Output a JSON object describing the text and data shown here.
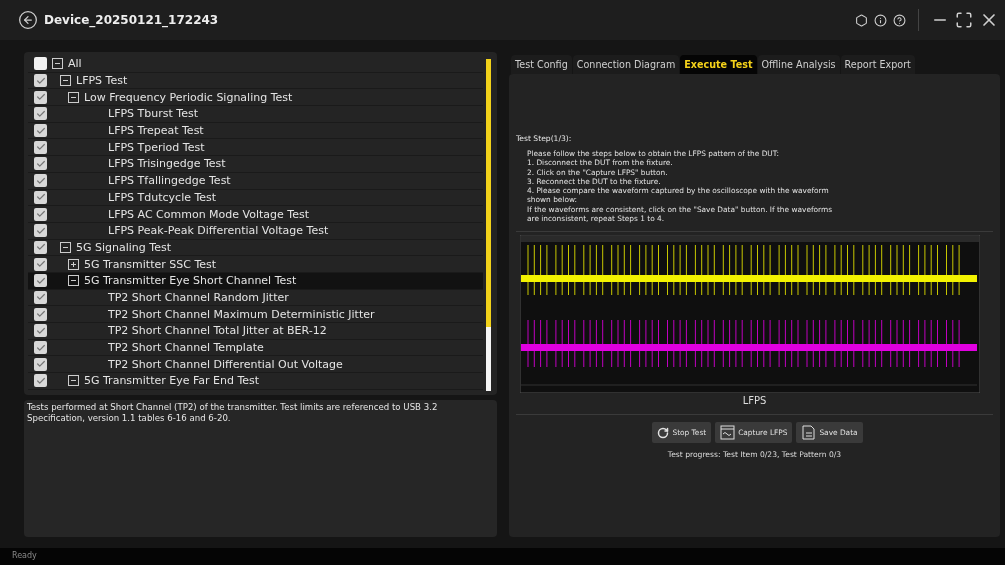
{
  "window": {
    "title": "Device_20250121_172243"
  },
  "tree": [
    {
      "label": "All",
      "checked": false,
      "expanded": true,
      "selected": false,
      "children": [
        {
          "label": "LFPS Test",
          "checked": true,
          "expanded": true,
          "selected": false,
          "children": [
            {
              "label": "Low Frequency Periodic Signaling Test",
              "checked": true,
              "expanded": true,
              "selected": false,
              "children": [
                {
                  "label": "LFPS Tburst Test",
                  "checked": true,
                  "selected": false
                },
                {
                  "label": "LFPS Trepeat Test",
                  "checked": true,
                  "selected": false
                },
                {
                  "label": "LFPS Tperiod Test",
                  "checked": true,
                  "selected": false
                },
                {
                  "label": "LFPS Trisingedge Test",
                  "checked": true,
                  "selected": false
                },
                {
                  "label": "LFPS Tfallingedge Test",
                  "checked": true,
                  "selected": false
                },
                {
                  "label": "LFPS Tdutcycle Test",
                  "checked": true,
                  "selected": false
                },
                {
                  "label": "LFPS AC Common Mode Voltage Test",
                  "checked": true,
                  "selected": false
                },
                {
                  "label": "LFPS Peak-Peak Differential Voltage Test",
                  "checked": true,
                  "selected": false
                }
              ]
            }
          ]
        },
        {
          "label": "5G Signaling Test",
          "checked": true,
          "expanded": true,
          "selected": false,
          "children": [
            {
              "label": "5G Transmitter SSC Test",
              "checked": true,
              "expanded": false,
              "selected": false
            },
            {
              "label": "5G Transmitter Eye Short Channel Test",
              "checked": true,
              "expanded": true,
              "selected": true,
              "children": [
                {
                  "label": "TP2 Short Channel Random Jitter",
                  "checked": true,
                  "selected": false
                },
                {
                  "label": "TP2 Short Channel Maximum Deterministic Jitter",
                  "checked": true,
                  "selected": false
                },
                {
                  "label": "TP2 Short Channel Total Jitter at BER-12",
                  "checked": true,
                  "selected": false
                },
                {
                  "label": "TP2 Short Channel Template",
                  "checked": true,
                  "selected": false
                },
                {
                  "label": "TP2 Short Channel Differential Out Voltage",
                  "checked": true,
                  "selected": false
                }
              ]
            },
            {
              "label": "5G Transmitter Eye Far End Test",
              "checked": true,
              "expanded": true,
              "selected": false
            }
          ]
        }
      ]
    }
  ],
  "description": "Tests performed at Short Channel (TP2) of the transmitter. Test limits are referenced to USB 3.2 Specification, version 1.1 tables 6-16 and 6-20.",
  "tabs": [
    {
      "label": "Test Config",
      "selected": false
    },
    {
      "label": "Connection Diagram",
      "selected": false
    },
    {
      "label": "Execute Test",
      "selected": true
    },
    {
      "label": "Offline Analysis",
      "selected": false
    },
    {
      "label": "Report Export",
      "selected": false
    }
  ],
  "step": {
    "heading": "Test Step(1/3):",
    "lines": [
      "Please follow the steps below to obtain the LFPS pattern of the DUT:",
      "1. Disconnect the DUT from the fixture.",
      "2. Click on the \"Capture LFPS\" button.",
      "3. Reconnect the DUT to the fixture.",
      "4. Please compare the waveform captured by the oscilloscope with the waveform shown below:",
      "If the waveforms are consistent, click on the \"Save Data\" button. If the waveforms are inconsistent, repeat Steps 1 to 4."
    ]
  },
  "waveform": {
    "caption": "LFPS"
  },
  "buttons": [
    {
      "label": "Stop Test",
      "kind": "refresh"
    },
    {
      "label": "Capture LFPS",
      "kind": "capture"
    },
    {
      "label": "Save Data",
      "kind": "save"
    }
  ],
  "progress": "Test progress: Test Item 0/23, Test Pattern 0/3",
  "status_bar": "Ready"
}
